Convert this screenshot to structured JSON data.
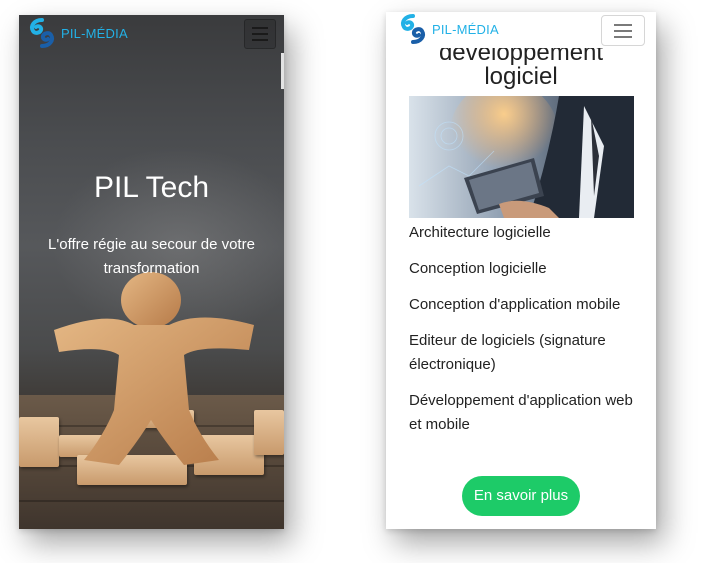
{
  "brand": {
    "name": "PIL-MÉDIA",
    "accent": "#22b1e6",
    "dark_accent": "#1a5fa8"
  },
  "screen_left": {
    "hero": {
      "title": "PIL Tech",
      "subtitle": "L'offre régie au secour de votre transformation",
      "background_subject": "wooden-person-figure"
    },
    "menu_icon": "hamburger-icon"
  },
  "screen_right": {
    "section_title_partial": "développement",
    "section_title": "logiciel",
    "image_subject": "person-using-laptop-with-data-charts",
    "services": [
      "Architecture logicielle",
      "Conception logicielle",
      "Conception d'application mobile",
      "Editeur de logiciels (signature électronique)",
      "Développement d'application web et mobile"
    ],
    "cta_label": "En savoir plus",
    "cta_color": "#1dcb68",
    "menu_icon": "hamburger-icon"
  }
}
